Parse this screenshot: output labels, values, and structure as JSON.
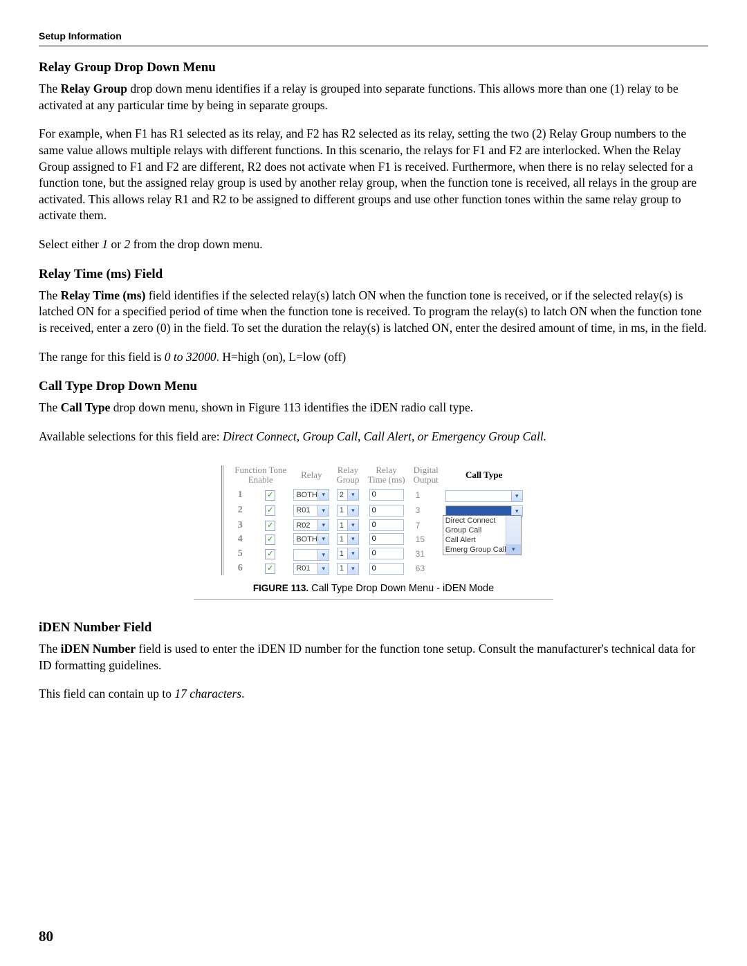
{
  "header": "Setup Information",
  "page_number": "80",
  "sections": {
    "relay_group": {
      "title": "Relay Group Drop Down Menu",
      "p1a": "The ",
      "p1b": "Relay Group",
      "p1c": " drop down menu identifies if a relay is grouped into separate functions. This allows more than one (1) relay to be activated at any particular time by being in separate groups.",
      "p2": "For example, when F1 has R1 selected as its relay, and F2 has R2 selected as its relay, setting the two (2) Relay Group numbers to the same value allows multiple relays with different functions. In this scenario, the relays for F1 and F2 are interlocked. When the Relay Group assigned to F1 and F2 are different, R2 does not activate when F1 is received. Furthermore, when there is no relay selected for a function tone, but the assigned relay group is used by another relay group, when the function tone is received, all relays in the group are activated. This allows relay R1 and R2 to be assigned to different groups and use other function tones within the same relay group to activate them.",
      "p3a": "Select either ",
      "p3b": "1",
      "p3c": " or ",
      "p3d": "2",
      "p3e": " from the drop down menu."
    },
    "relay_time": {
      "title": "Relay Time (ms) Field",
      "p1a": "The ",
      "p1b": "Relay Time (ms)",
      "p1c": " field identifies if the selected relay(s) latch ON when the function tone is received, or if the selected relay(s) is latched ON for a specified period of time when the function tone is received. To program the relay(s) to latch ON when the function tone is received, enter a zero (0) in the field. To set the duration the relay(s) is latched ON, enter the desired amount of time, in ms, in the field.",
      "p2a": "The range for this field is ",
      "p2b": "0 to 32000",
      "p2c": ". H=high (on), L=low (off)"
    },
    "call_type": {
      "title": "Call Type Drop Down Menu",
      "p1a": "The ",
      "p1b": "Call Type",
      "p1c": " drop down menu, shown in Figure 113 identifies the iDEN radio call type.",
      "p2a": "Available selections for this field are: ",
      "p2b": "Direct Connect, Group Call, Call Alert, or Emergency Group Call."
    },
    "iden": {
      "title": "iDEN Number Field",
      "p1a": "The ",
      "p1b": "iDEN Number",
      "p1c": " field is used to enter the iDEN ID number for the function tone setup. Consult the manufacturer's technical data for ID formatting guidelines.",
      "p2a": "This field can contain up to ",
      "p2b": "17 characters",
      "p2c": "."
    }
  },
  "figure": {
    "label": "FIGURE 113.",
    "caption": "Call Type Drop Down Menu - iDEN Mode",
    "headers": {
      "ft": "Function Tone\nEnable",
      "relay": "Relay",
      "group": "Relay\nGroup",
      "time": "Relay\nTime (ms)",
      "digital": "Digital\nOutput",
      "calltype": "Call Type"
    },
    "rows": [
      {
        "n": "1",
        "relay": "BOTH",
        "group": "2",
        "time": "0",
        "dig": "1"
      },
      {
        "n": "2",
        "relay": "R01",
        "group": "1",
        "time": "0",
        "dig": "3"
      },
      {
        "n": "3",
        "relay": "R02",
        "group": "1",
        "time": "0",
        "dig": "7"
      },
      {
        "n": "4",
        "relay": "BOTH",
        "group": "1",
        "time": "0",
        "dig": "15"
      },
      {
        "n": "5",
        "relay": "",
        "group": "1",
        "time": "0",
        "dig": "31"
      },
      {
        "n": "6",
        "relay": "R01",
        "group": "1",
        "time": "0",
        "dig": "63"
      }
    ],
    "dropdown_options": [
      "Direct Connect",
      "Group Call",
      "Call Alert",
      "Emerg Group Call"
    ]
  }
}
